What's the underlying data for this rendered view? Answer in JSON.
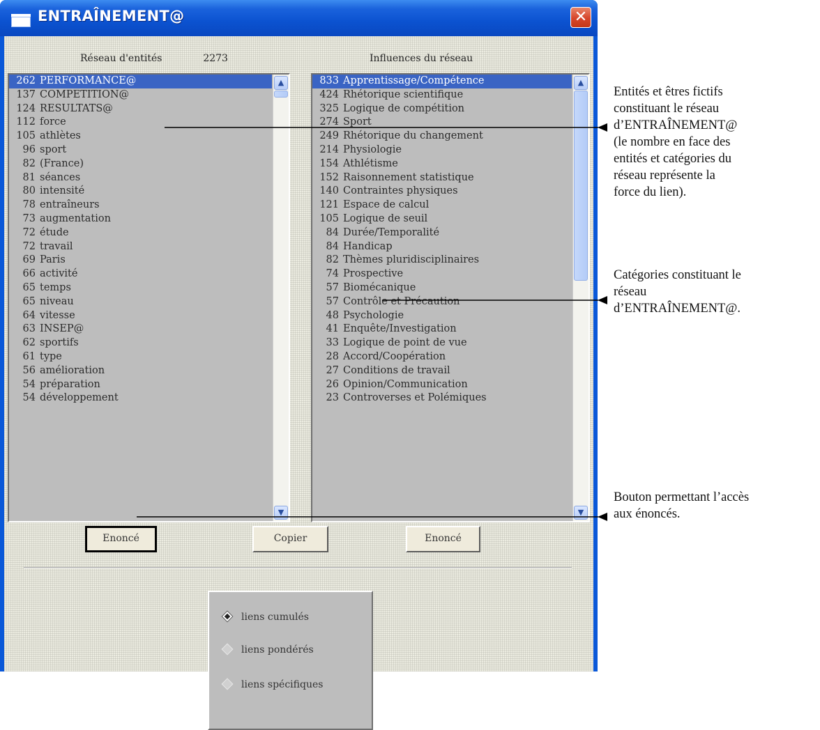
{
  "window": {
    "title": "ENTRAÎNEMENT@",
    "close_label": "✕"
  },
  "left_header": {
    "label": "Réseau d'entités",
    "count": "2273"
  },
  "right_header": {
    "label": "Influences du réseau"
  },
  "entities": [
    {
      "n": "262",
      "name": "PERFORMANCE@"
    },
    {
      "n": "137",
      "name": "COMPETITION@"
    },
    {
      "n": "124",
      "name": "RESULTATS@"
    },
    {
      "n": "112",
      "name": "force"
    },
    {
      "n": "105",
      "name": "athlètes"
    },
    {
      "n": "96",
      "name": "sport"
    },
    {
      "n": "82",
      "name": "(France)"
    },
    {
      "n": "81",
      "name": "séances"
    },
    {
      "n": "80",
      "name": "intensité"
    },
    {
      "n": "78",
      "name": "entraîneurs"
    },
    {
      "n": "73",
      "name": "augmentation"
    },
    {
      "n": "72",
      "name": "étude"
    },
    {
      "n": "72",
      "name": "travail"
    },
    {
      "n": "69",
      "name": "Paris"
    },
    {
      "n": "66",
      "name": "activité"
    },
    {
      "n": "65",
      "name": "temps"
    },
    {
      "n": "65",
      "name": "niveau"
    },
    {
      "n": "64",
      "name": "vitesse"
    },
    {
      "n": "63",
      "name": "INSEP@"
    },
    {
      "n": "62",
      "name": "sportifs"
    },
    {
      "n": "61",
      "name": "type"
    },
    {
      "n": "56",
      "name": "amélioration"
    },
    {
      "n": "54",
      "name": "préparation"
    },
    {
      "n": "54",
      "name": "développement"
    }
  ],
  "categories": [
    {
      "n": "833",
      "name": "Apprentissage/Compétence"
    },
    {
      "n": "424",
      "name": "Rhétorique scientifique"
    },
    {
      "n": "325",
      "name": "Logique de compétition"
    },
    {
      "n": "274",
      "name": "Sport"
    },
    {
      "n": "249",
      "name": "Rhétorique du changement"
    },
    {
      "n": "214",
      "name": "Physiologie"
    },
    {
      "n": "154",
      "name": "Athlétisme"
    },
    {
      "n": "152",
      "name": "Raisonnement statistique"
    },
    {
      "n": "140",
      "name": "Contraintes physiques"
    },
    {
      "n": "121",
      "name": "Espace de calcul"
    },
    {
      "n": "105",
      "name": "Logique de seuil"
    },
    {
      "n": "84",
      "name": "Durée/Temporalité"
    },
    {
      "n": "84",
      "name": "Handicap"
    },
    {
      "n": "82",
      "name": "Thèmes pluridisciplinaires"
    },
    {
      "n": "74",
      "name": "Prospective"
    },
    {
      "n": "57",
      "name": "Biomécanique"
    },
    {
      "n": "57",
      "name": "Contrôle et Précaution"
    },
    {
      "n": "48",
      "name": "Psychologie"
    },
    {
      "n": "41",
      "name": "Enquête/Investigation"
    },
    {
      "n": "33",
      "name": "Logique de point de vue"
    },
    {
      "n": "28",
      "name": "Accord/Coopération"
    },
    {
      "n": "27",
      "name": "Conditions de travail"
    },
    {
      "n": "26",
      "name": "Opinion/Communication"
    },
    {
      "n": "23",
      "name": "Controverses et Polémiques"
    }
  ],
  "buttons": {
    "left": "Enoncé",
    "copy": "Copier",
    "right": "Enoncé"
  },
  "radio": {
    "options": [
      "liens cumulés",
      "liens pondérés",
      "liens spécifiques"
    ],
    "selected": "liens cumulés"
  },
  "annotations": {
    "a1": [
      "Entités et êtres fictifs",
      "constituant le réseau",
      "d’ENTRAÎNEMENT@",
      "(le nombre en face des",
      "entités et catégories du",
      "réseau représente la",
      "force du lien)."
    ],
    "a2": [
      "Catégories constituant le",
      "réseau",
      "d’ENTRAÎNEMENT@."
    ],
    "a3": [
      "Bouton permettant l’accès",
      "aux énoncés."
    ]
  },
  "colors": {
    "titlebar": "#0b52d0",
    "selection": "#3a64c4",
    "list_bg": "#bdbdbd",
    "close": "#d6452a"
  }
}
